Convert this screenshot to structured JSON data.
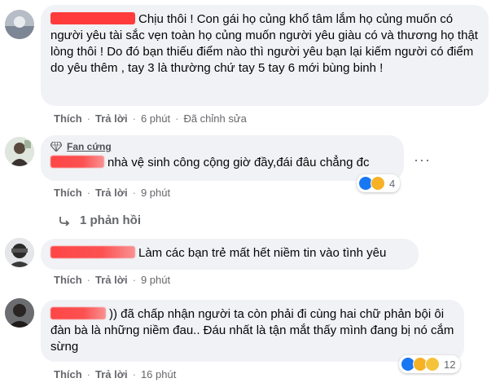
{
  "comments": [
    {
      "text": "Chịu thôi ! Con gái họ củng khổ tâm lắm họ củng muốn có người yêu tài sắc vẹn toàn họ củng muốn người yêu giàu có và thương họ thật lòng thôi ! Do đó bạn thiếu điểm nào thì người yêu bạn lại kiếm người có điểm do yêu thêm , tay 3 là thường chứ tay 5 tay 6 mới bùng binh !",
      "actions": {
        "like": "Thích",
        "reply": "Trả lời",
        "time": "6 phút",
        "edited": "Đã chỉnh sửa"
      }
    },
    {
      "badge": "Fan cứng",
      "text": "nhà vệ sinh công cộng giờ đầy,đái đâu chẳng đc",
      "actions": {
        "like": "Thích",
        "reply": "Trả lời",
        "time": "9 phút"
      },
      "reaction_count": "4",
      "replies": "1 phản hồi"
    },
    {
      "text": "Làm các bạn trẻ mất hết niềm tin vào tình yêu",
      "actions": {
        "like": "Thích",
        "reply": "Trả lời",
        "time": "9 phút"
      }
    },
    {
      "text": ")) đã chấp nhận người ta còn phải đi cùng hai chữ phản bội ôi đàn bà là những niềm đau.. Đáu nhất là tận mắt thấy mình đang bị nó cắm sừng",
      "actions": {
        "like": "Thích",
        "reply": "Trả lời",
        "time": "16 phút"
      },
      "reaction_count": "12"
    }
  ],
  "more_glyph": "···",
  "sep_glyph": "·",
  "colors": {
    "bubble": "#f0f2f5",
    "meta": "#65676b",
    "redaction": "#ff3b3b",
    "like_blue": "#1877f2",
    "haha_yellow": "#f7b125"
  }
}
